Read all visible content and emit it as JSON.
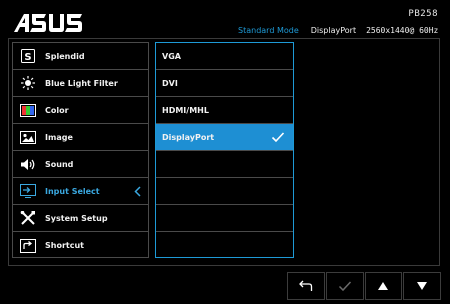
{
  "header": {
    "model": "PB258",
    "mode": "Standard Mode",
    "input": "DisplayPort",
    "resolution": "2560x1440@ 60Hz"
  },
  "menu": {
    "items": [
      {
        "label": "Splendid",
        "icon": "splendid-icon"
      },
      {
        "label": "Blue Light Filter",
        "icon": "blue-light-icon"
      },
      {
        "label": "Color",
        "icon": "color-icon"
      },
      {
        "label": "Image",
        "icon": "image-icon"
      },
      {
        "label": "Sound",
        "icon": "speaker-icon"
      },
      {
        "label": "Input Select",
        "icon": "input-select-icon",
        "active": true
      },
      {
        "label": "System Setup",
        "icon": "wrench-screwdriver-icon"
      },
      {
        "label": "Shortcut",
        "icon": "shortcut-icon"
      }
    ]
  },
  "submenu": {
    "items": [
      {
        "label": "VGA"
      },
      {
        "label": "DVI"
      },
      {
        "label": "HDMI/MHL"
      },
      {
        "label": "DisplayPort",
        "selected": true
      },
      {
        "label": ""
      },
      {
        "label": ""
      },
      {
        "label": ""
      },
      {
        "label": ""
      }
    ]
  },
  "buttons": [
    {
      "icon": "back-icon"
    },
    {
      "icon": "check-icon"
    },
    {
      "icon": "up-arrow-icon"
    },
    {
      "icon": "down-arrow-icon"
    }
  ],
  "colors": {
    "accent": "#1e9ad6",
    "selected": "#1e8fd3",
    "border": "#4a4a4a",
    "text": "#f2f2f2"
  }
}
